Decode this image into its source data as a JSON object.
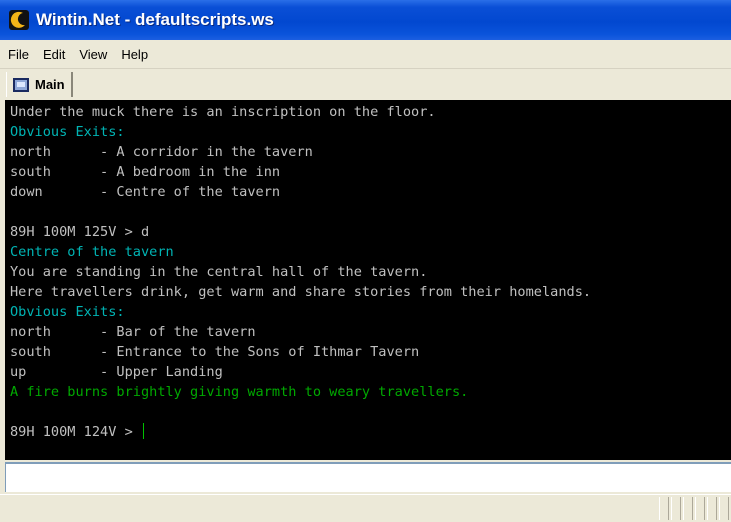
{
  "window": {
    "title": "Wintin.Net - defaultscripts.ws"
  },
  "menu": {
    "file": "File",
    "edit": "Edit",
    "view": "View",
    "help": "Help"
  },
  "tabs": [
    {
      "label": "Main"
    }
  ],
  "console": {
    "lines": [
      {
        "text": "Under the muck there is an inscription on the floor.",
        "color": "#c0c0c0"
      },
      {
        "text": "Obvious Exits:",
        "color": "#00b4b4"
      },
      {
        "text": "north      - A corridor in the tavern",
        "color": "#c0c0c0"
      },
      {
        "text": "south      - A bedroom in the inn",
        "color": "#c0c0c0"
      },
      {
        "text": "down       - Centre of the tavern",
        "color": "#c0c0c0"
      },
      {
        "text": "",
        "color": "#c0c0c0"
      },
      {
        "text": "89H 100M 125V > d",
        "color": "#c0c0c0"
      },
      {
        "text": "Centre of the tavern",
        "color": "#00b4b4"
      },
      {
        "text": "You are standing in the central hall of the tavern.",
        "color": "#c0c0c0"
      },
      {
        "text": "Here travellers drink, get warm and share stories from their homelands.",
        "color": "#c0c0c0"
      },
      {
        "text": "Obvious Exits:",
        "color": "#00b4b4"
      },
      {
        "text": "north      - Bar of the tavern",
        "color": "#c0c0c0"
      },
      {
        "text": "south      - Entrance to the Sons of Ithmar Tavern",
        "color": "#c0c0c0"
      },
      {
        "text": "up         - Upper Landing",
        "color": "#c0c0c0"
      },
      {
        "text": "A fire burns brightly giving warmth to weary travellers.",
        "color": "#00a800"
      },
      {
        "text": "",
        "color": "#c0c0c0"
      }
    ],
    "prompt": "89H 100M 124V > "
  },
  "input": {
    "value": ""
  },
  "colors": {
    "titlebar": "#0248d0",
    "console_bg": "#000000",
    "text_default": "#c0c0c0",
    "text_cyan": "#00b4b4",
    "text_green": "#00a800"
  }
}
